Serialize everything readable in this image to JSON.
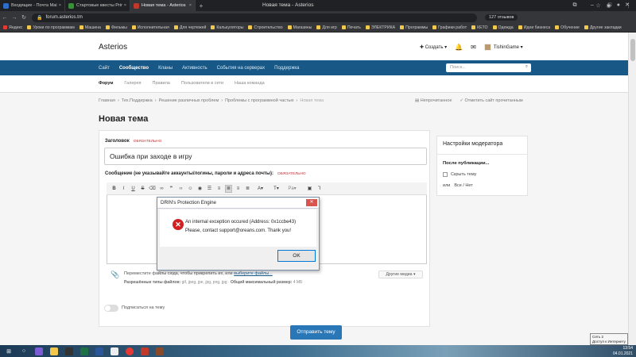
{
  "browser": {
    "tabs": [
      {
        "label": "Входящие - Почта Mail.ru",
        "color": "#2d6ec8"
      },
      {
        "label": "Стартовые квесты Prime",
        "color": "#3a8f3a"
      },
      {
        "label": "Новая тема - Asterios",
        "color": "#c0392b"
      }
    ],
    "window_title": "Новая тема - Asterios",
    "url": "forum.asterios.tm",
    "reviews": "127 отзывов",
    "bookmarks": [
      "Яндекс",
      "Уроки по программам",
      "Машина",
      "Фильмы",
      "Исполнительная",
      "Для чертежей",
      "Калькуляторы",
      "Строительство",
      "Магазины",
      "Для игр",
      "Печать",
      "ЭЛЕКТРИКА",
      "Программы",
      "Графики работ",
      "КЕТО",
      "Одежда",
      "Идеи бизнеса",
      "Обучение",
      "Другие закладки"
    ]
  },
  "site": {
    "logo": "Asterios",
    "create_label": "Создать",
    "username": "TishinGame",
    "nav": [
      "Сайт",
      "Сообщество",
      "Кланы",
      "Активность",
      "События на серверах",
      "Поддержка"
    ],
    "search_placeholder": "Поиск...",
    "subnav": [
      "Форум",
      "Галерея",
      "Правила",
      "Пользователи в сети",
      "Наша команда"
    ],
    "breadcrumbs": [
      "Главная",
      "Тех.Поддержка",
      "Решение различных проблем",
      "Проблемы с программной частью",
      "Новая тема"
    ],
    "bc_unread": "Непрочитанное",
    "bc_mark": "Отметить сайт прочитанным"
  },
  "page": {
    "title": "Новая тема",
    "field_title_label": "Заголовок",
    "required": "ОБЯЗАТЕЛЬНО",
    "title_value": "Ошибка при заходе в игру",
    "message_label": "Сообщение (не указывайте аккаунты/логины, пароли и адреса почты):",
    "attach_text": "Переместите файлы сюда, чтобы прикрепить их, или",
    "attach_link": "выберите файлы...",
    "allowed_label": "Разрешённые типы файлов:",
    "allowed_types": "gif, jpeg, jpe, jpg, png, jpg",
    "max_label": "Общий максимальный размер:",
    "max_size": "4 МБ",
    "media_btn": "Другие медиа",
    "follow_label": "Подписаться на тему",
    "submit": "Отправить тему"
  },
  "moderator": {
    "title": "Настройки модератора",
    "after_pub": "После публикации...",
    "hide": "Скрыть тему",
    "or": "или",
    "options": "Все / Нет"
  },
  "dialog": {
    "title": "DRIN's Protection Engine",
    "message1": "An internal exception occured (Address: 0x1ccbe43)",
    "message2": "Please, contact support@oreans.com. Thank you!",
    "ok": "OK"
  },
  "taskbar": {
    "time": "13:54",
    "date": "04.01.2021",
    "tooltip": "Сеть 2\nДоступ к Интернету"
  }
}
